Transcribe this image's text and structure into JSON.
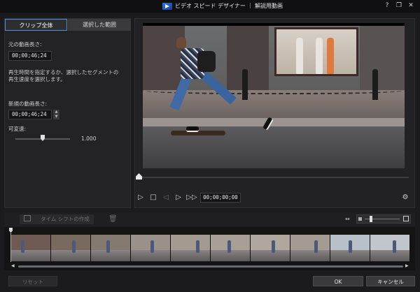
{
  "window": {
    "title": "ビデオ スピード デザイナー ｜ 解説用動画",
    "help_label": "?",
    "restore_label": "❐",
    "close_label": "✕"
  },
  "left_panel": {
    "tabs": [
      {
        "label": "クリップ全体",
        "active": true
      },
      {
        "label": "選択した範囲",
        "active": false
      }
    ],
    "original_length_label": "元の動画長さ:",
    "original_length_value": "00;00;46;24",
    "description": "再生時間を指定するか、選択したセグメントの再生速度を選択します。",
    "new_length_label": "新規の動画長さ:",
    "new_length_value": "00;00;46;24",
    "speed_label": "可変速:",
    "speed_value": "1.000",
    "speed_level": 1.0
  },
  "player": {
    "timecode": "00;00;00;00",
    "playhead_fraction": 0,
    "controls": {
      "play": "▷",
      "stop": "□",
      "prev_frame": "◁",
      "next_frame": "▷",
      "fast_forward": "▷▷",
      "settings": "⚙"
    }
  },
  "timeline": {
    "create_timeshift_label": "タイム シフトの作成",
    "trash_icon": "🗑",
    "fit_icon": "↔",
    "thumbnail_count": 10
  },
  "footer": {
    "reset_label": "リセット",
    "ok_label": "OK",
    "cancel_label": "キャンセル"
  }
}
